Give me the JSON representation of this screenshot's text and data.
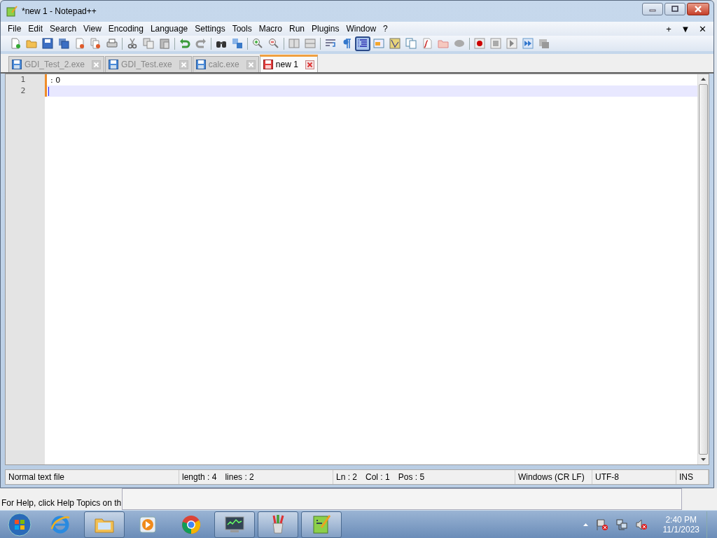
{
  "window": {
    "title": "*new 1 - Notepad++"
  },
  "menu": [
    "File",
    "Edit",
    "Search",
    "View",
    "Encoding",
    "Language",
    "Settings",
    "Tools",
    "Macro",
    "Run",
    "Plugins",
    "Window",
    "?"
  ],
  "menu_right": [
    "+",
    "▼",
    "✕"
  ],
  "toolbar": [
    {
      "buttons": [
        {
          "kind": "new",
          "pressed": false
        },
        {
          "kind": "open",
          "pressed": false
        },
        {
          "kind": "save",
          "pressed": false
        },
        {
          "kind": "save-all",
          "pressed": false
        },
        {
          "kind": "close",
          "pressed": false
        },
        {
          "kind": "close-all",
          "pressed": false
        },
        {
          "kind": "print",
          "pressed": false
        }
      ]
    },
    {
      "buttons": [
        {
          "kind": "cut",
          "pressed": false
        },
        {
          "kind": "copy",
          "pressed": false
        },
        {
          "kind": "paste",
          "pressed": false
        }
      ]
    },
    {
      "buttons": [
        {
          "kind": "undo",
          "pressed": false
        },
        {
          "kind": "redo",
          "pressed": false
        }
      ]
    },
    {
      "buttons": [
        {
          "kind": "find",
          "pressed": false
        },
        {
          "kind": "replace",
          "pressed": false
        }
      ]
    },
    {
      "buttons": [
        {
          "kind": "zoom-in",
          "pressed": false
        },
        {
          "kind": "zoom-out",
          "pressed": false
        }
      ]
    },
    {
      "buttons": [
        {
          "kind": "sync-v",
          "pressed": false
        },
        {
          "kind": "sync-h",
          "pressed": false
        }
      ]
    },
    {
      "buttons": [
        {
          "kind": "wrap",
          "pressed": false
        },
        {
          "kind": "all-chars",
          "pressed": false
        },
        {
          "kind": "indent-guide",
          "pressed": true
        },
        {
          "kind": "udl",
          "pressed": false
        },
        {
          "kind": "doc-map",
          "pressed": false
        },
        {
          "kind": "doc-list",
          "pressed": false
        },
        {
          "kind": "function-list",
          "pressed": false
        },
        {
          "kind": "folder-workspace",
          "pressed": false
        },
        {
          "kind": "monitor",
          "pressed": false
        }
      ]
    },
    {
      "buttons": [
        {
          "kind": "record",
          "pressed": false
        },
        {
          "kind": "stop",
          "pressed": false
        },
        {
          "kind": "play",
          "pressed": false
        },
        {
          "kind": "play-multi",
          "pressed": false
        },
        {
          "kind": "save-macro",
          "pressed": false
        }
      ]
    }
  ],
  "tabs": [
    {
      "label": "GDI_Test_2.exe",
      "selected": false,
      "modified": false
    },
    {
      "label": "GDI_Test.exe",
      "selected": false,
      "modified": false
    },
    {
      "label": "calc.exe",
      "selected": false,
      "modified": false
    },
    {
      "label": "new 1",
      "selected": true,
      "modified": true
    }
  ],
  "editor": {
    "lines": [
      {
        "number": "1",
        "text": ": 0",
        "current": false
      },
      {
        "number": "2",
        "current": true
      }
    ]
  },
  "status_bar": [
    {
      "texts": [
        "Normal text file"
      ]
    },
    {
      "texts": [
        "length : 4",
        "lines : 2"
      ]
    },
    {
      "texts": [
        "Ln : 2",
        "Col : 1",
        "Pos : 5"
      ]
    },
    {
      "texts": [
        "Windows (CR LF)"
      ]
    },
    {
      "texts": [
        "UTF-8"
      ]
    },
    {
      "texts": [
        "INS"
      ]
    }
  ],
  "background_window": {
    "status_text": "For Help, click Help Topics on th"
  },
  "taskbar": {
    "apps": [
      {
        "kind": "ie",
        "open": false
      },
      {
        "kind": "explorer",
        "open": true
      },
      {
        "kind": "media",
        "open": false
      },
      {
        "kind": "chrome",
        "open": false
      },
      {
        "kind": "monitor",
        "open": true
      },
      {
        "kind": "paint",
        "open": true
      },
      {
        "kind": "notepadpp",
        "open": true
      }
    ],
    "clock": {
      "time": "2:40 PM",
      "date": "11/1/2023"
    }
  }
}
